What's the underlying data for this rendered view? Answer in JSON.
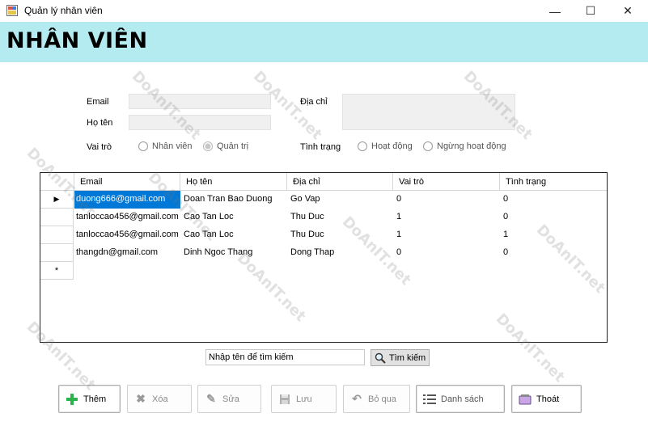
{
  "window": {
    "title": "Quản lý nhân viên",
    "minimize": "—",
    "maximize": "☐",
    "close": "✕"
  },
  "header": {
    "title": "NHÂN VIÊN"
  },
  "form": {
    "email_label": "Email",
    "email_value": "",
    "name_label": "Họ tên",
    "name_value": "",
    "address_label": "Địa chỉ",
    "address_value": "",
    "role_label": "Vai trò",
    "role_options": [
      "Nhân viên",
      "Quản trị"
    ],
    "role_selected": "Quản trị",
    "status_label": "Tình trạng",
    "status_options": [
      "Hoạt động",
      "Ngừng hoạt động"
    ]
  },
  "table": {
    "columns": [
      "Email",
      "Họ tên",
      "Địa chỉ",
      "Vai trò",
      "Tình trạng"
    ],
    "rows": [
      [
        "duong666@gmail.com",
        "Doan Tran Bao Duong",
        "Go Vap",
        "0",
        "0"
      ],
      [
        "tanloccao456@gmail.com",
        "Cao Tan Loc",
        "Thu Duc",
        "1",
        "0"
      ],
      [
        "tanloccao456@gmail.com",
        "Cao Tan Loc",
        "Thu Duc",
        "1",
        "1"
      ],
      [
        "thangdn@gmail.com",
        "Dinh Ngoc Thang",
        "Dong Thap",
        "0",
        "0"
      ]
    ],
    "current_row_marker": "▶",
    "new_row_marker": "*"
  },
  "search": {
    "value": "Nhập tên để tìm kiếm",
    "button_label": "Tìm kiếm"
  },
  "buttons": {
    "add": "Thêm",
    "delete": "Xóa",
    "edit": "Sửa",
    "save": "Lưu",
    "skip": "Bỏ qua",
    "list": "Danh sách",
    "exit": "Thoát"
  },
  "watermark": "DoAnIT.net",
  "colors": {
    "header_bg": "#b4ebf0",
    "selection": "#0078d7",
    "add_icon": "#2bb24c"
  }
}
